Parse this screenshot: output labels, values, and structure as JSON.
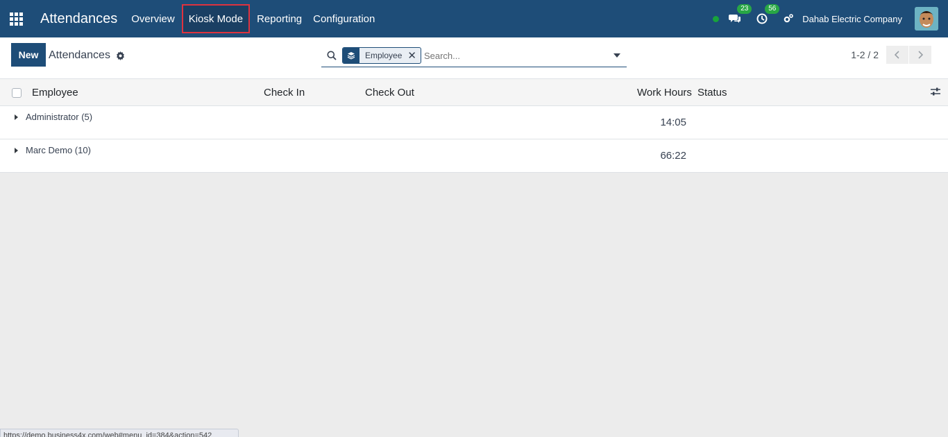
{
  "navbar": {
    "app_title": "Attendances",
    "menu": [
      "Overview",
      "Kiosk Mode",
      "Reporting",
      "Configuration"
    ],
    "messages_count": "23",
    "activities_count": "56",
    "company": "Dahab Electric Company"
  },
  "control_panel": {
    "new_label": "New",
    "breadcrumb": "Attendances",
    "facet_label": "Employee",
    "search_placeholder": "Search...",
    "pager_value": "1-2 / 2"
  },
  "table": {
    "columns": [
      "Employee",
      "Check In",
      "Check Out",
      "Work Hours",
      "Status"
    ],
    "groups": [
      {
        "label": "Administrator (5)",
        "work_hours": "14:05"
      },
      {
        "label": "Marc Demo (10)",
        "work_hours": "66:22"
      }
    ]
  },
  "statusbar": {
    "url": "https://demo.business4x.com/web#menu_id=384&action=542"
  },
  "colors": {
    "navbar": "#1e4d78",
    "highlight": "#e0323e",
    "badge": "#28a745"
  }
}
